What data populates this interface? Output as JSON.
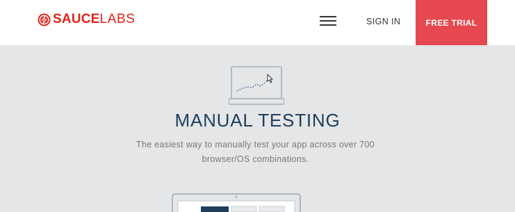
{
  "header": {
    "logo": {
      "icon": "saucelabs-bolt-icon",
      "text_sauce": "SAUCE",
      "text_labs": "LABS"
    },
    "menu_icon": "hamburger-menu-icon",
    "signin_label": "SIGN IN",
    "trial_label": "FREE TRIAL"
  },
  "hero": {
    "icon": "laptop-chart-cursor-icon",
    "title": "MANUAL TESTING",
    "description": "The easiest way to manually test your app across over 700 browser/OS combinations."
  },
  "next_section": {
    "icon": "laptop-icon"
  },
  "colors": {
    "brand_red": "#e2231a",
    "trial_button": "#e5484e",
    "page_background": "#e4e6e8",
    "title": "#1f3e5c"
  }
}
